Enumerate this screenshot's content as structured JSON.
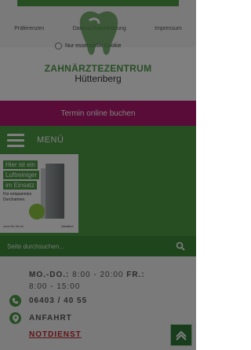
{
  "cookie": {
    "links": [
      "Präferenzen",
      "Datenschutzerklärung",
      "Impressum"
    ],
    "accept_label": "Nur essenzielle Cookie"
  },
  "brand": {
    "name": "ZAHNÄRZTEZENTRUM",
    "city": "Hüttenberg"
  },
  "booking": {
    "label": "Termin online buchen"
  },
  "menu": {
    "label": "MENÜ"
  },
  "ad": {
    "line1": "Hier ist ein",
    "line2": "Luftreiniger",
    "line3": "im Einsatz",
    "text": "Für entspanntes Durchatmen.",
    "url": "www.tfk-1tlt.de",
    "brand": "climaline"
  },
  "search": {
    "placeholder": "Seite durchsuchen..."
  },
  "contact": {
    "hours_label": "MO.-DO.:",
    "hours_value": "8:00 - 20:00",
    "hours_label2": "FR.:",
    "hours_value2": "8:00 - 15:00",
    "phone": "06403 / 40 55",
    "directions": "ANFAHRT",
    "emergency": "NOTDIENST"
  },
  "colors": {
    "brand_green": "#4f9b46",
    "booking_magenta": "#b3186e",
    "emergency_red": "#c2272d"
  }
}
